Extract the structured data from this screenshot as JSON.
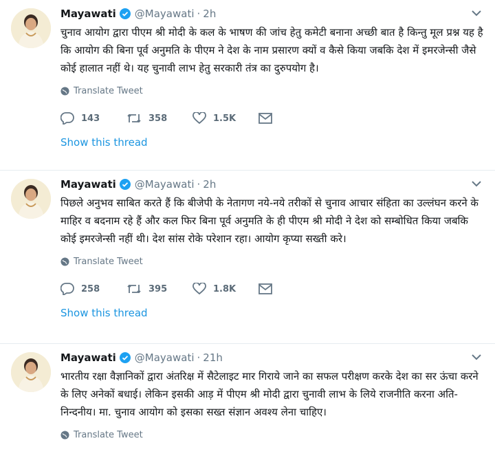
{
  "tweets": [
    {
      "name": "Mayawati",
      "handle": "@Mayawati",
      "time": "2h",
      "text": "चुनाव आयोग द्वारा पीएम श्री मोदी के कल के भाषण की जांच हेतु कमेटी बनाना अच्छी बात है किन्तु मूल प्रश्न यह है कि आयोग की बिना पूर्व अनुमति के पीएम ने देश के नाम प्रसारण क्यों व कैसे किया जबकि देश में इमरजेन्सी जैसे कोई हालात नहीं थे। यह चुनावी लाभ हेतु सरकारी तंत्र का दुरुपयोग है।",
      "translate": "Translate Tweet",
      "replies": "143",
      "retweets": "358",
      "likes": "1.5K",
      "thread": "Show this thread"
    },
    {
      "name": "Mayawati",
      "handle": "@Mayawati",
      "time": "2h",
      "text": "पिछले अनुभव साबित करते हैं कि बीजेपी के नेतागण नये-नये तरीकों से चुनाव आचार संहिता का उल्लंघन करने के माहिर व बदनाम रहे हैं और कल फिर बिना पूर्व अनुमति के ही पीएम श्री मोदी ने देश को सम्बोधित किया जबकि कोई इमरजेन्सी नहीं थी। देश सांस रोके परेशान रहा। आयोग कृप्या सख्ती करे।",
      "translate": "Translate Tweet",
      "replies": "258",
      "retweets": "395",
      "likes": "1.8K",
      "thread": "Show this thread"
    },
    {
      "name": "Mayawati",
      "handle": "@Mayawati",
      "time": "21h",
      "text": "भारतीय रक्षा वैज्ञानिकों द्वारा अंतरिक्ष में सैटेलाइट मार गिराये जाने का सफल परीक्षण करके देश का सर ऊंचा करने के लिए अनेकों बधाई। लेकिन इसकी आड़ में पीएम श्री मोदी द्वारा चुनावी लाभ के लिये राजनीति करना अति-निन्दनीय। मा. चुनाव आयोग को इसका सख्त संज्ञान अवश्य लेना चाहिए।",
      "translate": "Translate Tweet"
    }
  ],
  "colors": {
    "link": "#1b95e0",
    "muted": "#657786",
    "verified": "#1da1f2"
  }
}
